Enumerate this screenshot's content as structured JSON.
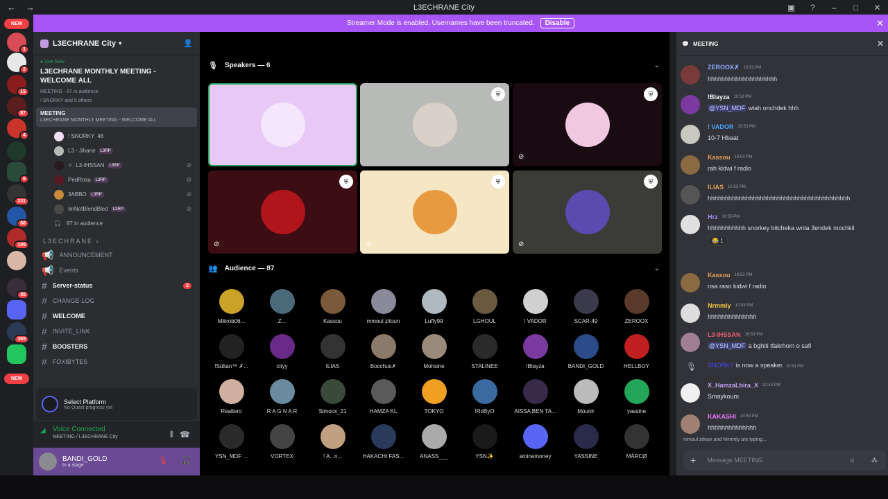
{
  "window": {
    "title": "L3ECHRANE City",
    "back": "←",
    "forward": "→"
  },
  "banner": {
    "text": "Streamer Mode is enabled. Usernames have been truncated.",
    "button": "Disable"
  },
  "guilds": {
    "new_label": "NEW",
    "badges": [
      "1",
      "2",
      "15",
      "87",
      "4",
      "6",
      "231",
      "66",
      "109",
      "85",
      "365"
    ]
  },
  "server": {
    "name": "L3ECHRANE City",
    "live_label": "Live Now",
    "event_title": "L3ECHRANE MONTHLY MEETING - WELCOME ALL",
    "event_channel": "MEETING",
    "event_audience": "87 in audience",
    "event_participants": "! SNORKY and 5 others",
    "voice_channel": {
      "name": "MEETING",
      "subtitle": "L3ECHRANE MONTHLY MEETING - WELCOME ALL"
    },
    "voice_users": [
      {
        "name": "! SNORKY",
        "extra": "48",
        "tag": ""
      },
      {
        "name": "L3 - Jihane",
        "extra": "",
        "tag": "L3RP"
      },
      {
        "name": "✧. L3-IHSSAN",
        "extra": "",
        "tag": "L3RP"
      },
      {
        "name": "PedRosa",
        "extra": "",
        "tag": "L3RP"
      },
      {
        "name": "3ABBO",
        "extra": "",
        "tag": "L3RP"
      },
      {
        "name": "ImNotBlendBled",
        "extra": "",
        "tag": "L3RP"
      }
    ],
    "audience_line": "87 in audience",
    "category": "L3ECHRANE",
    "channels": [
      {
        "name": "ANNOUNCEMENT",
        "bold": false,
        "badge": ""
      },
      {
        "name": "Events",
        "bold": false,
        "badge": ""
      },
      {
        "name": "Server-status",
        "bold": true,
        "badge": "2"
      },
      {
        "name": "CHANGE-LOG",
        "bold": false,
        "badge": ""
      },
      {
        "name": "WELCOME",
        "bold": true,
        "badge": ""
      },
      {
        "name": "INVITE_LINK",
        "bold": false,
        "badge": ""
      },
      {
        "name": "BOOSTERS",
        "bold": true,
        "badge": ""
      },
      {
        "name": "FOXIBYTES",
        "bold": false,
        "badge": ""
      }
    ]
  },
  "quest": {
    "title": "Select Platform",
    "subtitle": "No Quest progress yet"
  },
  "voice": {
    "status": "Voice Connected",
    "location": "MEETING / L3ECHRANE City"
  },
  "user": {
    "name": "BANDI_GOLD",
    "status": "In a stage"
  },
  "stage": {
    "speakers_label": "Speakers — 6",
    "audience_label": "Audience — 87",
    "speaker_colors": [
      "#e8c8f5",
      "#b8bab8",
      "#1a0b12",
      "#3d0d14",
      "#f5e6c4",
      "#3b3b38"
    ],
    "audience": [
      "Mikrob06...",
      "Z...",
      "Kassou",
      "mmoul zitoun",
      "Luffy99",
      "LGHOUL",
      "! VADOR",
      "SCAR-49",
      "ZEROOX",
      "!Sültan™ ✗...",
      "cityy",
      "ILIAS",
      "Bocchus✗",
      "Mohsine",
      "STALINEE",
      "!Blayza",
      "BANDI_GOLD",
      "HELLBOY",
      "Realtero",
      "R A G N A R",
      "Simoox_21",
      "HAMZA KL",
      "TOKYO",
      "!RoByO",
      "AISSA BEN TA...",
      "Mounir",
      "yassine",
      "YSN_MDF ...",
      "VORTEX",
      "! A...n...",
      "HAKACHI FAS...",
      "ANASS___",
      "YSN✨",
      "aminemoney",
      "YASSINE",
      "MÄRCØ"
    ]
  },
  "chat": {
    "header": "MEETING",
    "messages": [
      {
        "author": "ZEROOX✗",
        "time": "10:53 PM",
        "text": "hhhhhhhhhhhhhhhhhhhh",
        "color": "#8fa8ff"
      },
      {
        "author": "!Blayza",
        "time": "10:53 PM",
        "mention": "@YSN_MDF",
        "text": "wlah onchdek hhh",
        "color": "#f2f3f5"
      },
      {
        "author": "! VADOR",
        "time": "10:53 PM",
        "text": "10-7 Hbaat",
        "color": "#4aa3ff"
      },
      {
        "author": "Kassou",
        "time": "10:53 PM",
        "text": "rah kidwi f radio",
        "color": "#e6a35a"
      },
      {
        "author": "ILIAS",
        "time": "10:53 PM",
        "text": "hhhhhhhhhhhhhhhhhhhhhhhhhhhhhhhhhhhhhhhhh",
        "color": "#e6a35a"
      },
      {
        "author": "Hrz",
        "time": "10:53 PM",
        "text": "hhhhhhhhhhh snorkey bitcheka wnta 3endek mochkil",
        "color": "#a78bfa",
        "reaction": "1"
      },
      {
        "author": "Kassou",
        "time": "10:53 PM",
        "text": "nsa raso kidwi f radio",
        "color": "#e6a35a"
      },
      {
        "author": "Nrmmly",
        "time": "10:53 PM",
        "text": "hhhhhhhhhhhhhh",
        "color": "#f5c542"
      },
      {
        "author": "L3-IHSSAN",
        "time": "10:53 PM",
        "mention": "@YSN_MDF",
        "text": "a bghiti tfakrhom o safi",
        "color": "#e85d75"
      },
      {
        "author": "SNORKY",
        "time": "10:53 PM",
        "text": "is now a speaker.",
        "color": "#4a4aff"
      },
      {
        "author": "X_HamzaLbira_X",
        "time": "10:53 PM",
        "text": "Smaykoum",
        "color": "#c6a0f5"
      },
      {
        "author": "KAKASHI",
        "time": "10:53 PM",
        "text": "hhhhhhhhhhhhhh",
        "color": "#e879f9"
      }
    ],
    "typing": "mmoul zitoun and Nrmmly are typing...",
    "placeholder": "Message MEETING"
  }
}
